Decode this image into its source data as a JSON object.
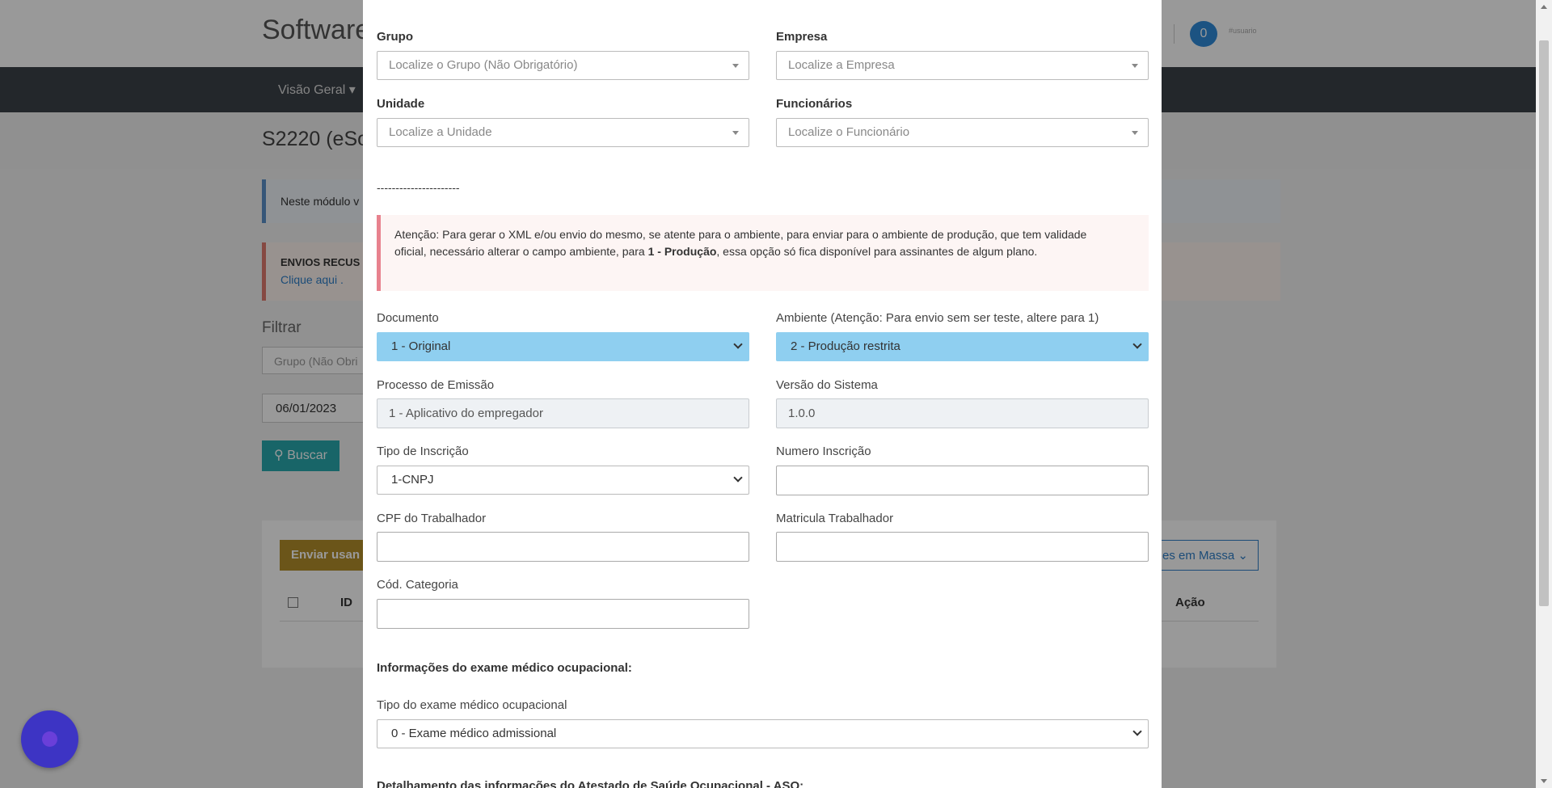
{
  "background": {
    "brand": "Software",
    "notification_count": "0",
    "user_label": "#usuario",
    "nav_item": "Visão Geral",
    "page_title": "S2220 (eSo",
    "info_alert": "Neste módulo v",
    "error_alert_title": "ENVIOS RECUS",
    "error_alert_link": "Clique aqui .",
    "filter_heading": "Filtrar",
    "filter_group_placeholder": "Grupo (Não Obri",
    "filter_date": "06/01/2023",
    "search_button": "Buscar",
    "send_button": "Enviar usan",
    "mass_button": "es em Massa",
    "col_id": "ID",
    "col_action": "Ação"
  },
  "modal": {
    "grupo": {
      "label": "Grupo",
      "placeholder": "Localize o Grupo (Não Obrigatório)"
    },
    "empresa": {
      "label": "Empresa",
      "placeholder": "Localize a Empresa"
    },
    "unidade": {
      "label": "Unidade",
      "placeholder": "Localize a Unidade"
    },
    "funcionarios": {
      "label": "Funcionários",
      "placeholder": "Localize o Funcionário"
    },
    "separator": "----------------------",
    "warning": {
      "before": "Atenção: Para gerar o XML e/ou envio do mesmo, se atente para o ambiente, para enviar para o ambiente de produção, que tem validade oficial, necessário alterar o campo ambiente, para ",
      "bold": "1 - Produção",
      "after": ", essa opção só fica disponível para assinantes de algum plano."
    },
    "documento": {
      "label": "Documento",
      "value": "1 - Original"
    },
    "ambiente": {
      "label": "Ambiente (Atenção: Para envio sem ser teste, altere para 1)",
      "value": "2 - Produção restrita"
    },
    "processo_emissao": {
      "label": "Processo de Emissão",
      "value": "1 - Aplicativo do empregador"
    },
    "versao_sistema": {
      "label": "Versão do Sistema",
      "value": "1.0.0"
    },
    "tipo_inscricao": {
      "label": "Tipo de Inscrição",
      "value": "1-CNPJ"
    },
    "numero_inscricao": {
      "label": "Numero Inscrição",
      "value": ""
    },
    "cpf_trabalhador": {
      "label": "CPF do Trabalhador",
      "value": ""
    },
    "matricula_trabalhador": {
      "label": "Matricula Trabalhador",
      "value": ""
    },
    "cod_categoria": {
      "label": "Cód. Categoria",
      "value": ""
    },
    "section_exame": "Informações do exame médico ocupacional:",
    "tipo_exame": {
      "label": "Tipo do exame médico ocupacional",
      "value": "0 - Exame médico admissional"
    },
    "section_aso": "Detalhamento das informações do Atestado de Saúde Ocupacional - ASO:"
  },
  "colors": {
    "select_highlight": "#8fcff0",
    "warning_border": "#e8828e",
    "nav_bg": "#3b4148",
    "accent": "#2f7fc8"
  }
}
